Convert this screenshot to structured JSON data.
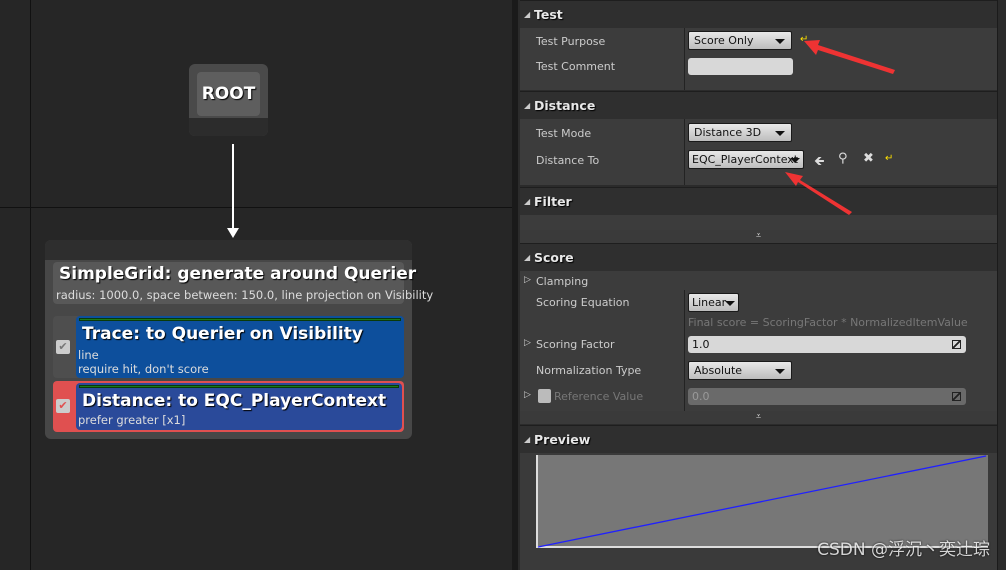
{
  "graph": {
    "root": "ROOT",
    "generator": {
      "title": "SimpleGrid: generate around Querier",
      "subtitle": "radius: 1000.0, space between: 150.0, line projection on Visibility"
    },
    "tests": [
      {
        "title": "Trace: to Querier on Visibility",
        "lines": [
          "line",
          "require hit, don't score"
        ],
        "enabled": true,
        "selected": false
      },
      {
        "title": "Distance: to EQC_PlayerContext",
        "lines": [
          "prefer greater [x1]"
        ],
        "enabled": true,
        "selected": true
      }
    ]
  },
  "details": {
    "test": {
      "header": "Test",
      "purpose_label": "Test Purpose",
      "purpose_value": "Score Only",
      "comment_label": "Test Comment",
      "comment_value": ""
    },
    "distance": {
      "header": "Distance",
      "mode_label": "Test Mode",
      "mode_value": "Distance 3D",
      "to_label": "Distance To",
      "to_value": "EQC_PlayerContext"
    },
    "filter": {
      "header": "Filter"
    },
    "score": {
      "header": "Score",
      "clamping": "Clamping",
      "equation_label": "Scoring Equation",
      "equation_value": "Linear",
      "equation_hint": "Final score = ScoringFactor * NormalizedItemValue",
      "factor_label": "Scoring Factor",
      "factor_value": "1.0",
      "normalization_label": "Normalization Type",
      "normalization_value": "Absolute",
      "reference_label": "Reference Value",
      "reference_value": "0.0",
      "reference_enabled": false
    },
    "preview": {
      "header": "Preview",
      "curve": {
        "type": "line",
        "x": [
          0,
          1
        ],
        "y": [
          0,
          1
        ],
        "line_color": "#2020ff",
        "background": "#777777"
      }
    }
  },
  "watermark": "CSDN @浮沉丶奕辻琮",
  "colors": {
    "trace_card": "#0d4f9c",
    "distance_card": "#2a4a9a",
    "selected_border": "#e05050",
    "annotation_arrow": "#ee3333"
  }
}
